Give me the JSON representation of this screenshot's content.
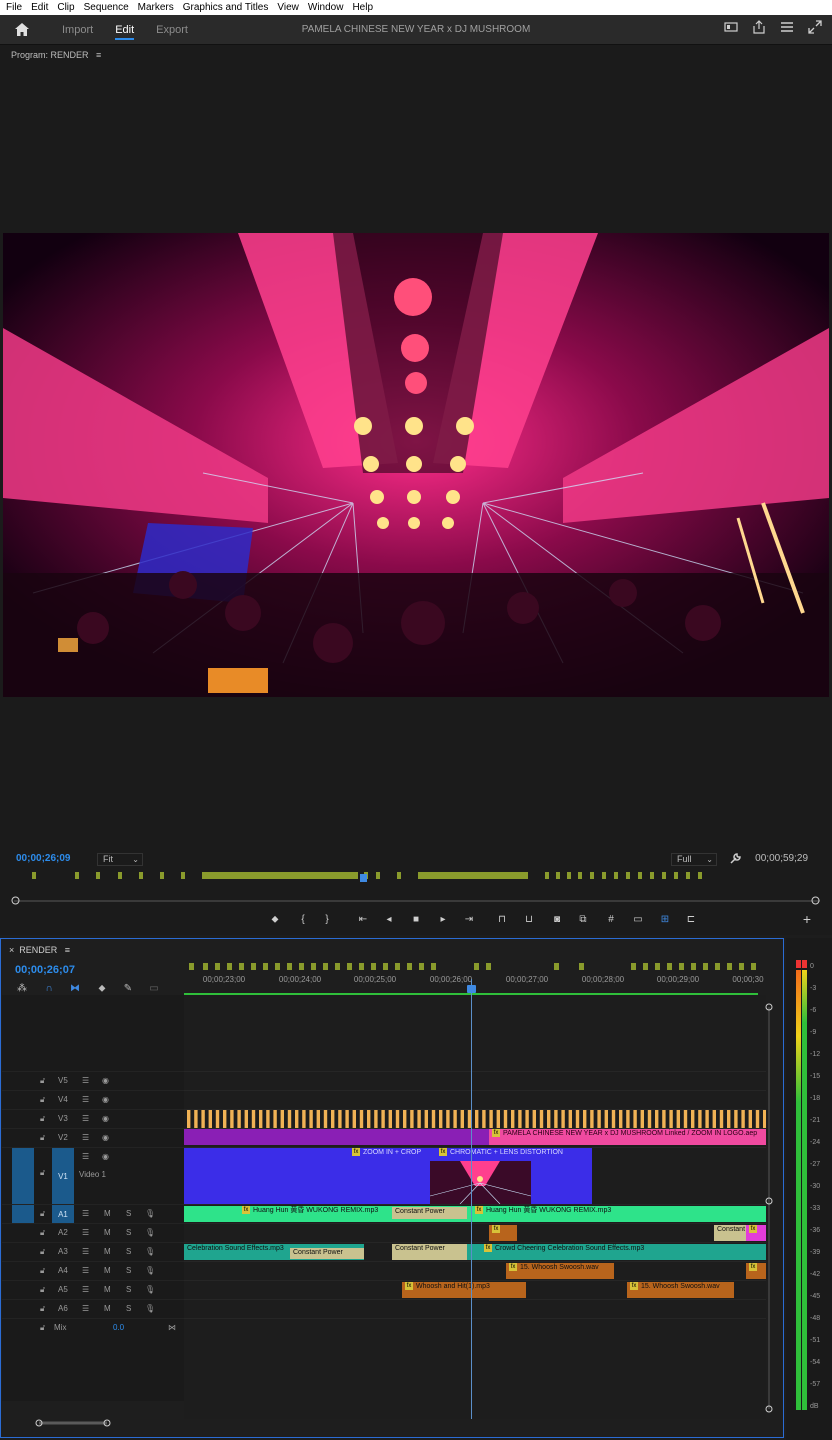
{
  "menu": [
    "File",
    "Edit",
    "Clip",
    "Sequence",
    "Markers",
    "Graphics and Titles",
    "View",
    "Window",
    "Help"
  ],
  "header": {
    "tabs": [
      {
        "label": "Import",
        "active": false
      },
      {
        "label": "Edit",
        "active": true
      },
      {
        "label": "Export",
        "active": false
      }
    ],
    "project_title": "PAMELA CHINESE NEW YEAR x DJ MUSHROOM"
  },
  "program": {
    "title": "Program: RENDER",
    "timecode_current": "00;00;26;09",
    "zoom": "Fit",
    "quality": "Full",
    "timecode_duration": "00;00;59;29"
  },
  "timeline": {
    "title": "RENDER",
    "timecode": "00;00;26;07",
    "ruler_labels": [
      "00;00;23;00",
      "00;00;24;00",
      "00;00;25;00",
      "00;00;26;00",
      "00;00;27;00",
      "00;00;28;00",
      "00;00;29;00",
      "00;00;30"
    ],
    "tracks": {
      "v5": "V5",
      "v4": "V4",
      "v3": "V3",
      "v2": "V2",
      "v1": "V1",
      "v1_name": "Video 1",
      "a1": "A1",
      "a2": "A2",
      "a3": "A3",
      "a4": "A4",
      "a5": "A5",
      "a6": "A6",
      "mix": "Mix",
      "mix_value": "0.0"
    },
    "track_letters": {
      "m": "M",
      "s": "S"
    },
    "source_v1": "V1",
    "source_a1": "A1",
    "clips": {
      "v2_title": "PAMELA CHINESE NEW YEAR x DJ MUSHROOM Linked / ZOOM IN LOGO.aep",
      "v1_zoom": "ZOOM IN + CROP",
      "v1_chromatic": "CHROMATIC + LENS DISTORTION",
      "a1_huang_1": "Huang Hun 黄昏  WUKONG REMIX.mp3",
      "a1_constant_power": "Constant Power",
      "a1_huang_2": "Huang Hun 黄昏  WUKONG REMIX.mp3",
      "a2_constant": "Constant",
      "a3_celebration": "Celebration  Sound Effects.mp3",
      "a3_constant_power_1": "Constant Power",
      "a3_constant_power_2": "Constant Power",
      "a3_crowd": "Crowd Cheering  Celebration  Sound Effects.mp3",
      "a4_whoosh": "15. Whoosh Swoosh.wav",
      "a5_whoosh_hit": "Whoosh and Hit(1).mp3",
      "a5_whoosh_2": "15. Whoosh Swoosh.wav"
    }
  },
  "meter": {
    "labels": [
      "0",
      "-3",
      "-6",
      "-9",
      "-12",
      "-15",
      "-18",
      "-21",
      "-24",
      "-27",
      "-30",
      "-33",
      "-36",
      "-39",
      "-42",
      "-45",
      "-48",
      "-51",
      "-54",
      "-57",
      "dB"
    ]
  },
  "colors": {
    "accent": "#2d8ceb",
    "audio_clip": "#2ee38a",
    "audio_clip_teal": "#1fa58f",
    "v1_clip": "#3b2de8",
    "v2_clip": "#8a1fb5",
    "title_clip": "#f04aa0",
    "marker": "#8a9b2c",
    "orange_clip": "#b8641c"
  }
}
